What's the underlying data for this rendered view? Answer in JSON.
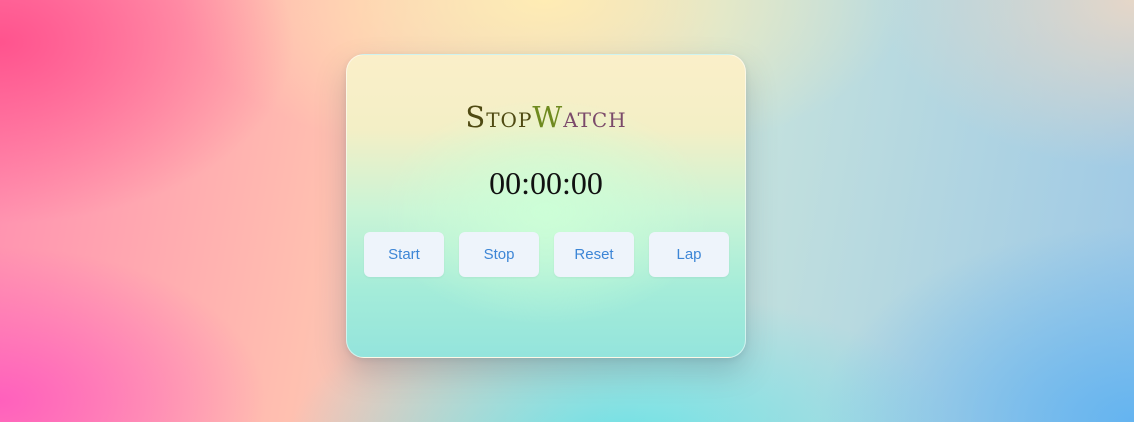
{
  "stopwatch": {
    "title_parts": [
      "Stop",
      "W",
      "atch"
    ],
    "time": "00:00:00",
    "buttons": {
      "start": "Start",
      "stop": "Stop",
      "reset": "Reset",
      "lap": "Lap"
    }
  },
  "colors": {
    "button_text": "#3d86d6",
    "button_bg": "#eef4fb",
    "title_stop": "#4f4a12",
    "title_w": "#6f8a1f",
    "title_atch": "#7b4a6a"
  }
}
